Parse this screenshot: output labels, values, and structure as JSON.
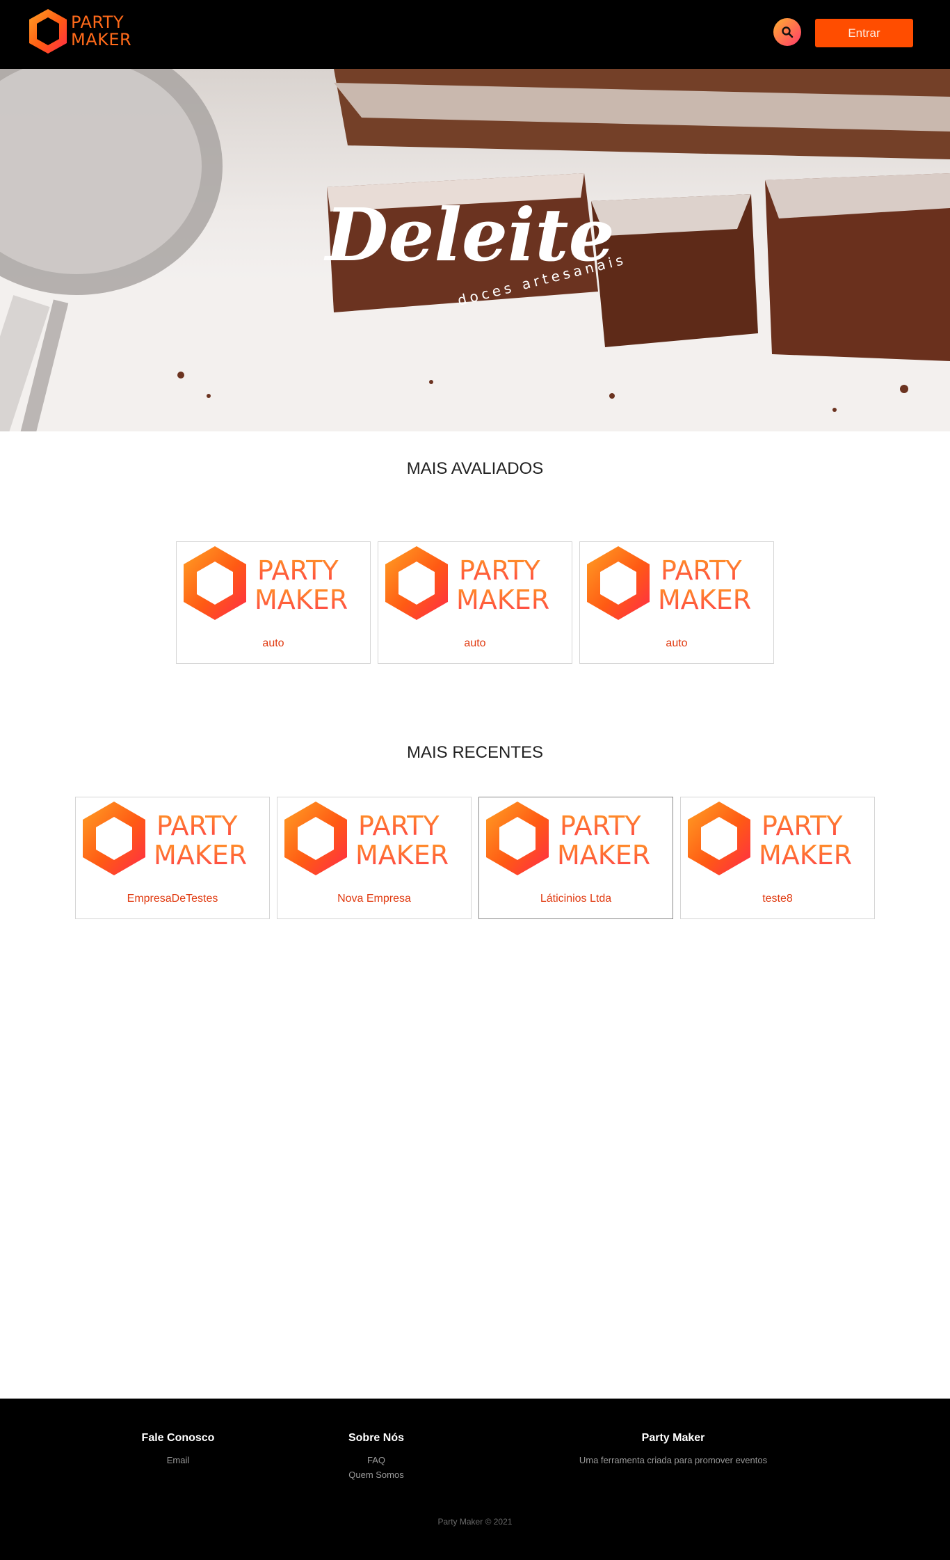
{
  "header": {
    "brand_line1": "PARTY",
    "brand_line2": "MAKER",
    "search_icon": "search-icon",
    "login_label": "Entrar"
  },
  "banner": {
    "title": "Deleite",
    "subtitle": "doces artesanais"
  },
  "card_logo": {
    "line1": "PARTY",
    "line2": "MAKER"
  },
  "top_rated": {
    "title": "MAIS AVALIADOS",
    "items": [
      {
        "name": "auto"
      },
      {
        "name": "auto"
      },
      {
        "name": "auto"
      }
    ]
  },
  "recent": {
    "title": "MAIS RECENTES",
    "items": [
      {
        "name": "EmpresaDeTestes"
      },
      {
        "name": "Nova Empresa"
      },
      {
        "name": "Láticinios Ltda"
      },
      {
        "name": "teste8"
      }
    ]
  },
  "footer": {
    "contact": {
      "title": "Fale Conosco",
      "links": [
        "Email"
      ]
    },
    "about": {
      "title": "Sobre Nós",
      "links": [
        "FAQ",
        "Quem Somos"
      ]
    },
    "brand": {
      "title": "Party Maker",
      "text": "Uma ferramenta criada para promover eventos"
    },
    "copyright": "Party Maker © 2021"
  },
  "colors": {
    "accent": "#ff4d00",
    "brand_orange": "#ff6a1a",
    "card_text": "#e03a10"
  }
}
